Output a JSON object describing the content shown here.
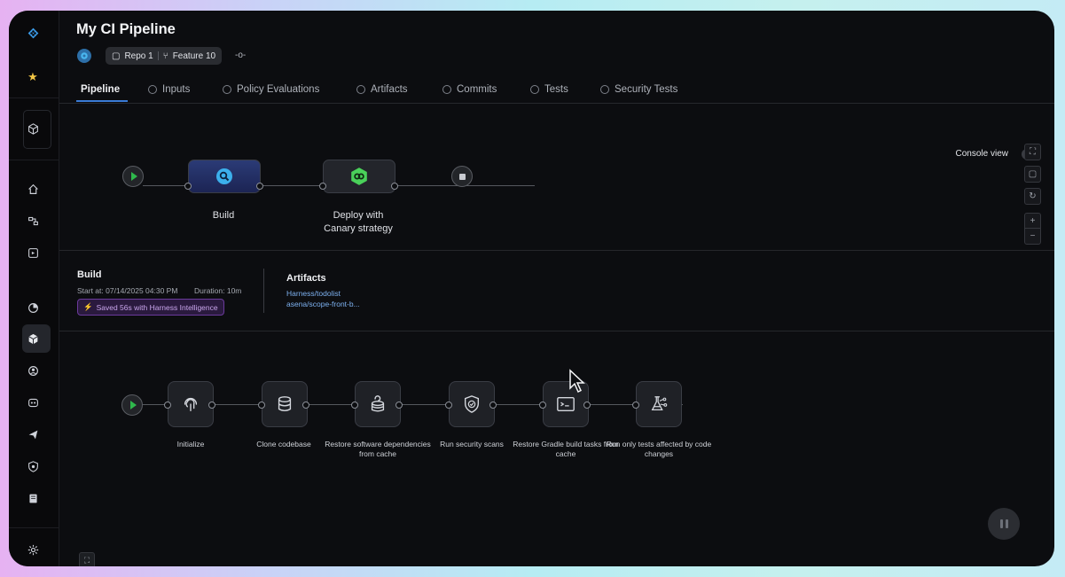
{
  "app": {
    "title": "My CI Pipeline"
  },
  "header": {
    "repo": "Repo 1",
    "branch": "Feature 10"
  },
  "tabs": [
    {
      "label": "Pipeline",
      "active": true
    },
    {
      "label": "Inputs"
    },
    {
      "label": "Policy Evaluations"
    },
    {
      "label": "Artifacts"
    },
    {
      "label": "Commits"
    },
    {
      "label": "Tests"
    },
    {
      "label": "Security Tests"
    }
  ],
  "console_view": {
    "label": "Console view",
    "enabled": false
  },
  "stages": [
    {
      "label": "Build",
      "icon": "build-icon"
    },
    {
      "label": "Deploy with\nCanary strategy",
      "icon": "deploy-icon"
    }
  ],
  "build_info": {
    "title": "Build",
    "start_at": "Start at: 07/14/2025 04:30 PM",
    "duration": "Duration: 10m",
    "badge": "Saved 56s with Harness Intelligence",
    "artifacts_title": "Artifacts",
    "artifacts": [
      "Harness/todolist",
      "asena/scope-front-b..."
    ]
  },
  "steps": [
    {
      "label": "Initialize",
      "icon": "fingerprint-icon"
    },
    {
      "label": "Clone codebase",
      "icon": "database-icon"
    },
    {
      "label": "Restore software dependencies from cache",
      "icon": "database-restore-icon"
    },
    {
      "label": "Run security scans",
      "icon": "shield-check-icon"
    },
    {
      "label": "Restore Gradle build tasks from cache",
      "icon": "terminal-icon"
    },
    {
      "label": "Run only tests affected by code changes",
      "icon": "flask-icon"
    }
  ],
  "colors": {
    "accent": "#3a7bd5",
    "start": "#2fb84c",
    "badge": "#c9a5ec"
  }
}
